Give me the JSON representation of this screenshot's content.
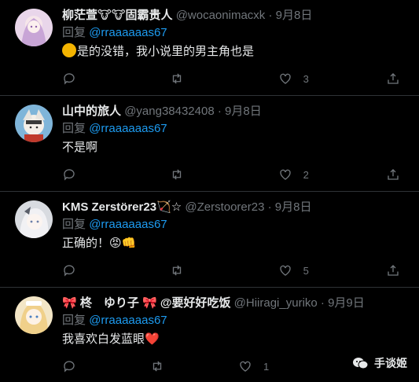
{
  "tweets": [
    {
      "name": "柳茫萱🐮🐮固霸贵人",
      "handle": "@wocaonimacxk",
      "dot": "·",
      "date": "9月8日",
      "reply_prefix": "回复",
      "reply_to": "@rraaaaaas67",
      "text": "是的没错，我小说里的男主角也是",
      "likes": "3"
    },
    {
      "name": "山中的旅人",
      "handle": "@yang38432408",
      "dot": "·",
      "date": "9月8日",
      "reply_prefix": "回复",
      "reply_to": "@rraaaaaas67",
      "text": "不是啊",
      "likes": "2"
    },
    {
      "name": "KMS Zerstörer23🏹☆",
      "handle": "@Zerstoorer23",
      "dot": "·",
      "date": "9月8日",
      "reply_prefix": "回复",
      "reply_to": "@rraaaaaas67",
      "text": "正确的！😡👊",
      "likes": "5"
    },
    {
      "name": "🎀 柊　ゆり子 🎀 @要好好吃饭",
      "handle": "@Hiiragi_yuriko",
      "dot": "·",
      "date": "9月9日",
      "reply_prefix": "回复",
      "reply_to": "@rraaaaaas67",
      "text": "我喜欢白发蓝眼❤️",
      "likes": "1"
    }
  ],
  "watermark": {
    "label": "手谈姬"
  },
  "icons": [
    "reply-icon",
    "retweet-icon",
    "like-icon",
    "share-icon"
  ],
  "colors": {
    "background": "#000000",
    "mention": "#1d9bf0",
    "muted": "#71767b",
    "text": "#e7e9ea"
  }
}
